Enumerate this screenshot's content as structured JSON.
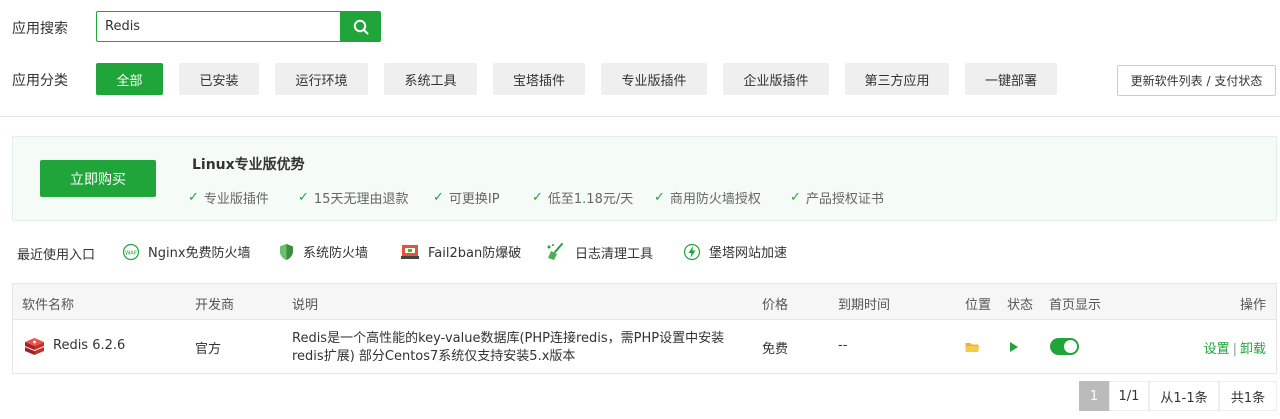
{
  "search": {
    "label": "应用搜索",
    "value": "Redis"
  },
  "category": {
    "label": "应用分类",
    "items": [
      "全部",
      "已安装",
      "运行环境",
      "系统工具",
      "宝塔插件",
      "专业版插件",
      "企业版插件",
      "第三方应用",
      "一键部署"
    ],
    "active": "全部"
  },
  "refresh_label": "更新软件列表 / 支付状态",
  "promo": {
    "buy_label": "立即购买",
    "title": "Linux专业版优势",
    "features": [
      "专业版插件",
      "15天无理由退款",
      "可更换IP",
      "低至1.18元/天",
      "商用防火墙授权",
      "产品授权证书"
    ]
  },
  "recent": {
    "label": "最近使用入口",
    "items": [
      {
        "name": "Nginx免费防火墙",
        "icon": "waf-icon"
      },
      {
        "name": "系统防火墙",
        "icon": "shield-icon"
      },
      {
        "name": "Fail2ban防爆破",
        "icon": "fail2ban-icon"
      },
      {
        "name": "日志清理工具",
        "icon": "broom-icon"
      },
      {
        "name": "堡塔网站加速",
        "icon": "lightning-icon"
      }
    ]
  },
  "table": {
    "headers": [
      "软件名称",
      "开发商",
      "说明",
      "价格",
      "到期时间",
      "位置",
      "状态",
      "首页显示",
      "操作"
    ],
    "rows": [
      {
        "name": "Redis 6.2.6",
        "developer": "官方",
        "description": "Redis是一个高性能的key-value数据库(PHP连接redis，需PHP设置中安装redis扩展) 部分Centos7系统仅支持安装5.x版本",
        "price": "免费",
        "expire": "--",
        "homepage_display": true,
        "actions": [
          "设置",
          "卸载"
        ]
      }
    ]
  },
  "pagination": {
    "current": "1",
    "pages": "1/1",
    "range": "从1-1条",
    "total": "共1条"
  },
  "colors": {
    "accent": "#20a53a"
  }
}
